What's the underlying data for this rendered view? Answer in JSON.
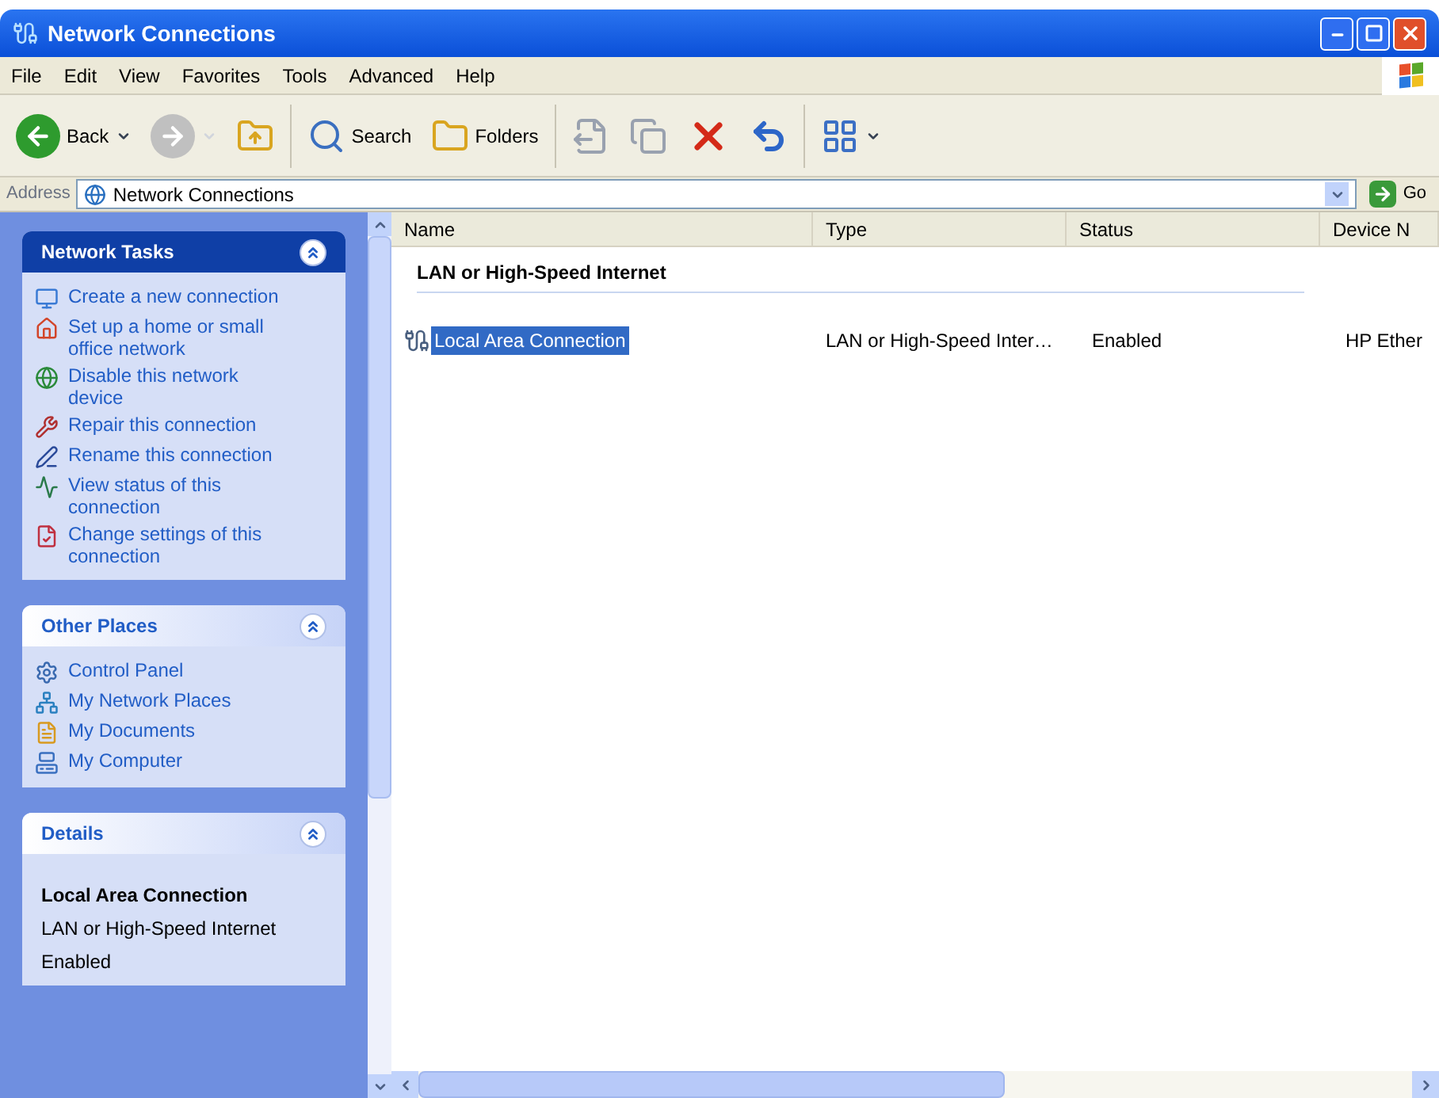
{
  "window": {
    "title": "Network Connections"
  },
  "menu": [
    "File",
    "Edit",
    "View",
    "Favorites",
    "Tools",
    "Advanced",
    "Help"
  ],
  "toolbar": [
    {
      "kind": "back",
      "label": "Back",
      "disabled": false
    },
    {
      "kind": "forward",
      "disabled": true
    },
    {
      "kind": "up",
      "disabled": false
    },
    {
      "kind": "search",
      "label": "Search",
      "disabled": false
    },
    {
      "kind": "folders",
      "label": "Folders",
      "disabled": false
    },
    {
      "kind": "move",
      "disabled": true
    },
    {
      "kind": "copy",
      "disabled": true
    },
    {
      "kind": "delete",
      "disabled": false
    },
    {
      "kind": "undo",
      "disabled": false
    },
    {
      "kind": "views",
      "disabled": false
    }
  ],
  "address": {
    "label": "Address",
    "value": "Network Connections",
    "go": "Go"
  },
  "panels": [
    {
      "kind": "special",
      "title": "Network Tasks",
      "items": [
        "Create a new connection",
        "Set up a home or small office network",
        "Disable this network device",
        "Repair this connection",
        "Rename this connection",
        "View status of this connection",
        "Change settings of this connection"
      ]
    },
    {
      "kind": "normal",
      "title": "Other Places",
      "items": [
        "Control Panel",
        "My Network Places",
        "My Documents",
        "My Computer"
      ]
    },
    {
      "kind": "details",
      "title": "Details",
      "name": "Local Area Connection",
      "lines": [
        "LAN or High-Speed Internet",
        "Enabled"
      ]
    }
  ],
  "list": {
    "columns": [
      "Name",
      "Type",
      "Status",
      "Device N"
    ],
    "groups": [
      {
        "title": "LAN or High-Speed Internet",
        "rows": [
          {
            "name": "Local Area Connection",
            "type": "LAN or High-Speed Inter…",
            "status": "Enabled",
            "device": "HP Ether",
            "selected": true
          }
        ]
      }
    ]
  }
}
